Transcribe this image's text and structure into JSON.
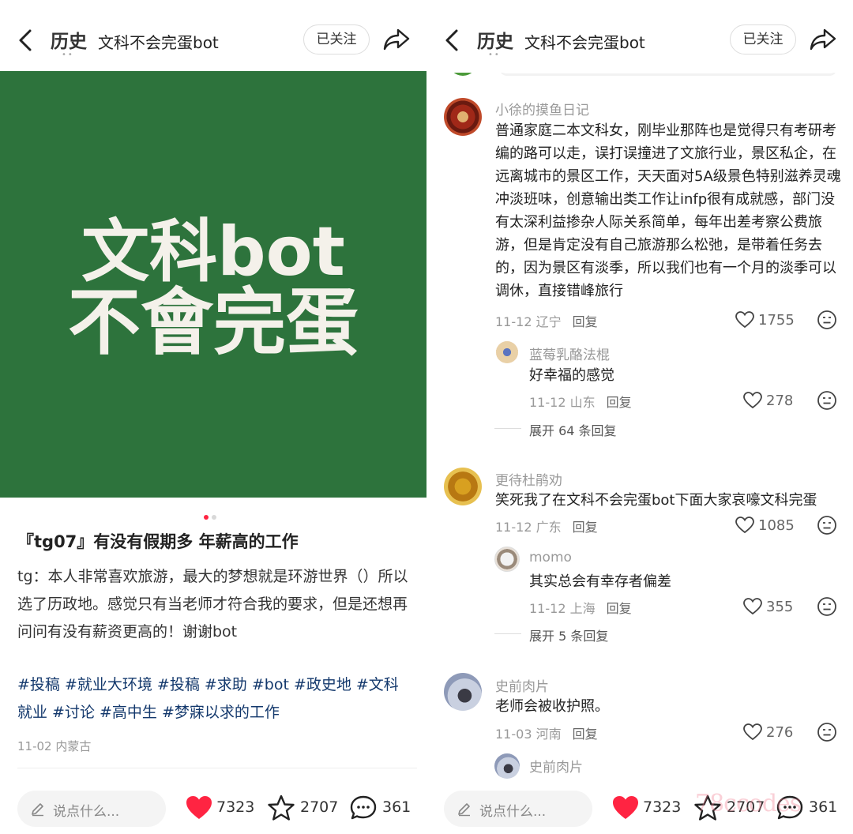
{
  "header": {
    "history_label": "历史",
    "history_dots": "••",
    "title": "文科不会完蛋bot",
    "follow_label": "已关注"
  },
  "post": {
    "cover_text_line1": "文科bot",
    "cover_text_line2": "不會完蛋",
    "title": "『tg07』有没有假期多 年薪高的工作",
    "body": "tg：本人非常喜欢旅游，最大的梦想就是环游世界（）所以选了历政地。感觉只有当老师才符合我的要求，但是还想再问问有没有薪资更高的！谢谢bot",
    "tags": "#投稿 #就业大环境 #投稿 #求助 #bot #政史地 #文科就业 #讨论 #高中生 #梦寐以求的工作",
    "meta": "11-02 内蒙古"
  },
  "bottom_bar": {
    "input_placeholder": "说点什么...",
    "likes": "7323",
    "favorites": "2707",
    "comments": "361"
  },
  "comments": [
    {
      "author": "小徐的摸鱼日记",
      "text": "普通家庭二本文科女，刚毕业那阵也是觉得只有考研考编的路可以走，误打误撞进了文旅行业，景区私企，在远离城市的景区工作，天天面对5A级景色特别滋养灵魂冲淡班味，创意输出类工作让infp很有成就感，部门没有太深利益掺杂人际关系简单，每年出差考察公费旅游，但是肯定没有自己旅游那么松弛，是带着任务去的，因为景区有淡季，所以我们也有一个月的淡季可以调休，直接错峰旅行",
      "date_loc": "11-12 辽宁",
      "reply": "回复",
      "likes": "1755",
      "replies": [
        {
          "author": "蓝莓乳酪法棍",
          "text": "好幸福的感觉",
          "date_loc": "11-12 山东",
          "reply": "回复",
          "likes": "278"
        }
      ],
      "expand": "展开 64 条回复"
    },
    {
      "author": "更待杜鹃劝",
      "text": "笑死我了在文科不会完蛋bot下面大家哀嚎文科完蛋",
      "date_loc": "11-12 广东",
      "reply": "回复",
      "likes": "1085",
      "replies": [
        {
          "author": "momo",
          "text": "其实总会有幸存者偏差",
          "date_loc": "11-12 上海",
          "reply": "回复",
          "likes": "355"
        }
      ],
      "expand": "展开 5 条回复"
    },
    {
      "author": "史前肉片",
      "text": "老师会被收护照。",
      "date_loc": "11-03 河南",
      "reply": "回复",
      "likes": "276",
      "next_author": "史前肉片"
    }
  ],
  "watermark": "78ccodes",
  "colors": {
    "accent": "#ff2442",
    "cover_green": "#2d733c",
    "tag_blue": "#13386c"
  }
}
